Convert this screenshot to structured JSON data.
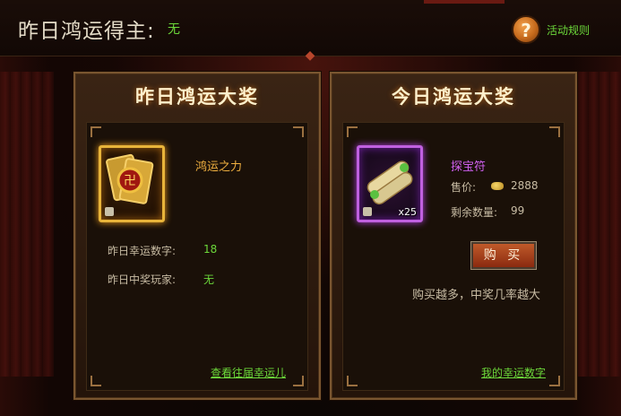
{
  "header": {
    "title": "昨日鸿运得主:",
    "value": "无",
    "help_label": "活动规则",
    "help_icon_glyph": "?"
  },
  "left_panel": {
    "title": "昨日鸿运大奖",
    "item_name": "鸿运之力",
    "lucky_number_label": "昨日幸运数字:",
    "lucky_number": "18",
    "winner_label": "昨日中奖玩家:",
    "winner": "无",
    "history_link": "查看往届幸运儿"
  },
  "right_panel": {
    "title": "今日鸿运大奖",
    "item_name": "探宝符",
    "item_count": "x25",
    "price_label": "售价:",
    "price": "2888",
    "remaining_label": "剩余数量:",
    "remaining": "99",
    "buy_label": "购 买",
    "hint": "购买越多，中奖几率越大",
    "my_numbers_link": "我的幸运数字"
  },
  "colors": {
    "accent_green": "#6cd83a",
    "gold_frame": "#e8b43a",
    "purple_frame": "#c060e0",
    "item_name_gold": "#f0b040",
    "item_name_purple": "#d060f0"
  },
  "icons": {
    "help": "question-circle-icon",
    "currency": "gold-ingot-icon",
    "lock": "lock-icon"
  }
}
